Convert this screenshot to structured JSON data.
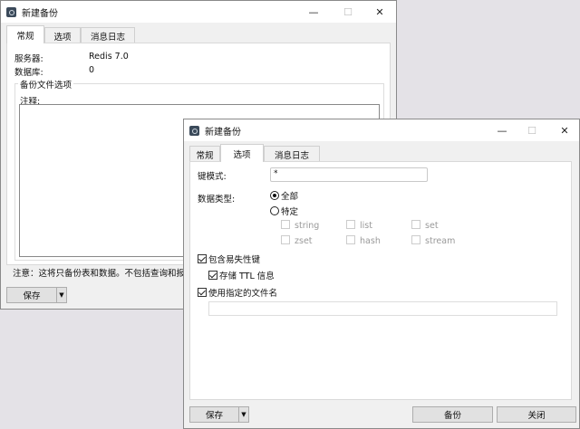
{
  "back_window": {
    "title": "新建备份",
    "tabs": [
      "常规",
      "选项",
      "消息日志"
    ],
    "active_tab": "常规",
    "server_label": "服务器:",
    "server_value": "Redis 7.0",
    "db_label": "数据库:",
    "db_value": "0",
    "group_label": "备份文件选项",
    "comment_label": "注释:",
    "comment_value": "",
    "note": "注意：这将只备份表和数据。不包括查询和报表",
    "save_label": "保存"
  },
  "front_window": {
    "title": "新建备份",
    "tabs": [
      "常规",
      "选项",
      "消息日志"
    ],
    "active_tab": "选项",
    "key_pattern_label": "键模式:",
    "key_pattern_value": "*",
    "data_type_label": "数据类型:",
    "radio_all": "全部",
    "radio_specific": "特定",
    "selected_radio": "全部",
    "types": [
      "string",
      "list",
      "set",
      "zset",
      "hash",
      "stream"
    ],
    "include_volatile": {
      "label": "包含易失性键",
      "checked": true
    },
    "store_ttl": {
      "label": "存储 TTL 信息",
      "checked": true
    },
    "use_filename": {
      "label": "使用指定的文件名",
      "checked": true
    },
    "filename_value": "",
    "save_label": "保存",
    "backup_label": "备份",
    "close_label": "关闭"
  },
  "icons": {
    "minimize": "—",
    "maximize": "☐",
    "close": "✕",
    "dropdown": "▼"
  }
}
